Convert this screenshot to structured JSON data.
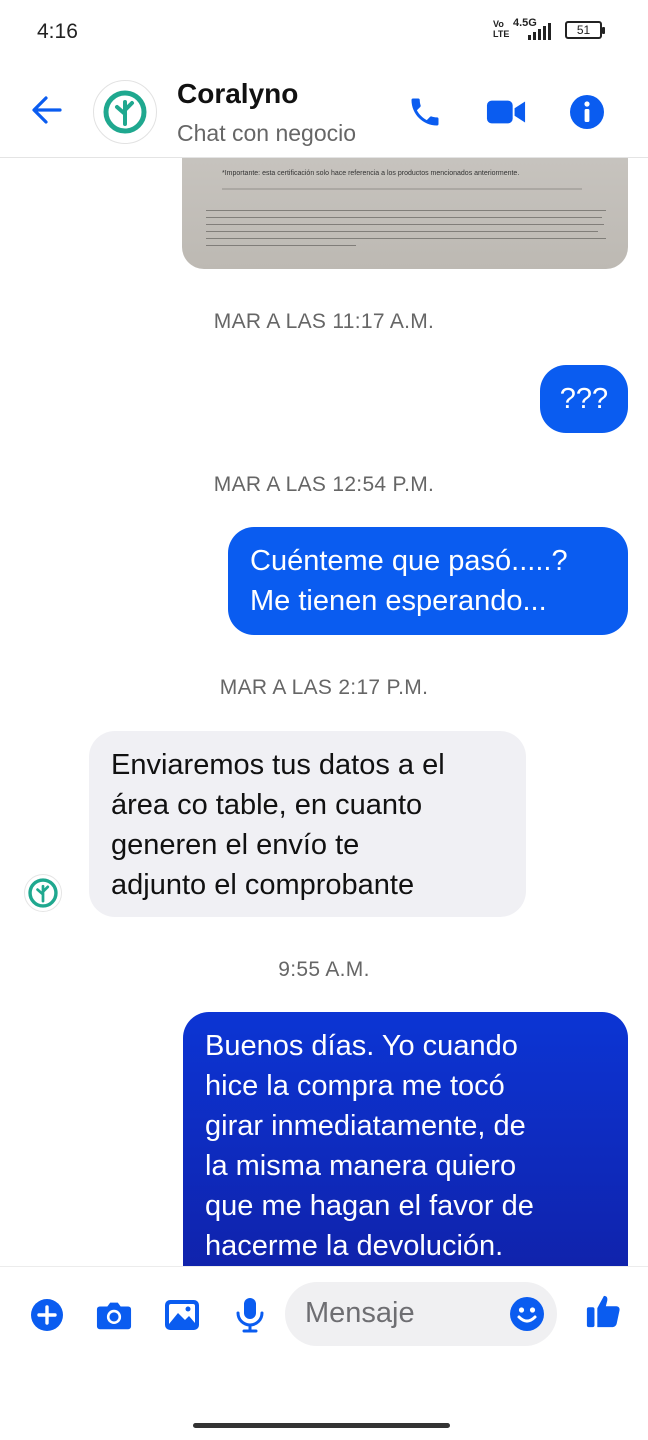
{
  "status_bar": {
    "time": "4:16",
    "network_top": "Vo",
    "network_bottom": "LTE",
    "network_gen": "4.5G",
    "battery": "51"
  },
  "header": {
    "contact_name": "Coralyno",
    "subtitle": "Chat con negocio",
    "back_icon": "arrow-left-icon",
    "call_icon": "phone-icon",
    "video_icon": "video-camera-icon",
    "info_icon": "info-icon"
  },
  "colors": {
    "accent": "#0a5cf0",
    "brand_green": "#1fa88f",
    "bubble_incoming": "#f0f0f4",
    "bubble_dark": "#1021a8"
  },
  "document_preview": {
    "important_text": "*Importante: esta certificación solo hace referencia a los productos mencionados anteriormente."
  },
  "messages": [
    {
      "type": "timestamp",
      "text": "MAR A LAS 11:17 A.M."
    },
    {
      "type": "outgoing",
      "lines": [
        "???"
      ]
    },
    {
      "type": "timestamp",
      "text": "MAR A LAS 12:54 P.M."
    },
    {
      "type": "outgoing",
      "lines": [
        "Cuénteme que pasó.....?",
        "Me tienen esperando..."
      ]
    },
    {
      "type": "timestamp",
      "text": "MAR A LAS 2:17 P.M."
    },
    {
      "type": "incoming",
      "lines": [
        "Enviaremos tus datos a el",
        "área co table, en cuanto",
        "generen el envío te",
        "adjunto el  comprobante"
      ]
    },
    {
      "type": "timestamp",
      "text": "9:55 A.M."
    },
    {
      "type": "outgoing",
      "lines": [
        "Buenos días. Yo cuando",
        "hice la compra me tocó",
        "girar inmediatamente, de",
        "la misma manera quiero",
        "que me hagan el favor de",
        "hacerme la devolución."
      ]
    }
  ],
  "composer": {
    "placeholder": "Mensaje",
    "icons": [
      "plus-icon",
      "camera-icon",
      "gallery-icon",
      "microphone-icon",
      "emoji-icon",
      "thumbs-up-icon"
    ]
  }
}
